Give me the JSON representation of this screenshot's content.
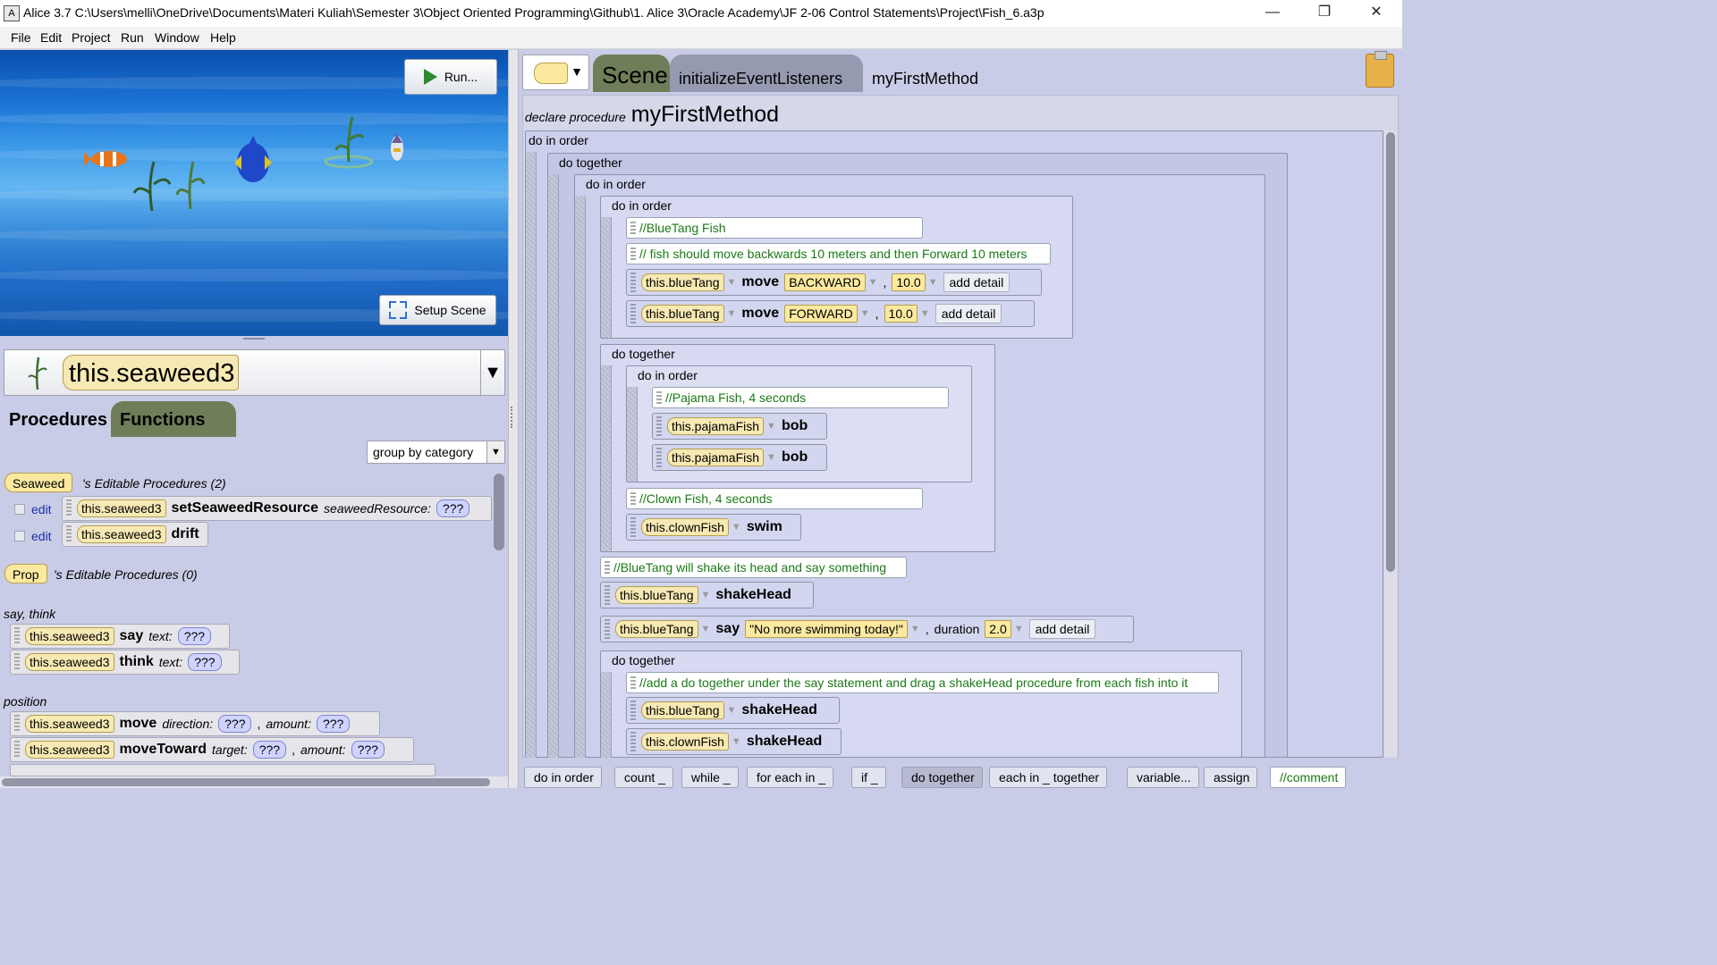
{
  "window": {
    "title": "Alice 3.7 C:\\Users\\melli\\OneDrive\\Documents\\Materi Kuliah\\Semester 3\\Object Oriented Programming\\Github\\1. Alice 3\\Oracle Academy\\JF 2-06 Control Statements\\Project\\Fish_6.a3p",
    "minimize": "—",
    "restore": "❐",
    "close": "✕"
  },
  "menu": [
    "File",
    "Edit",
    "Project",
    "Run",
    "Window",
    "Help"
  ],
  "scene": {
    "run_label": "Run...",
    "setup_scene_label": "Setup Scene"
  },
  "selector": {
    "selected": "this.seaweed3",
    "arrow": "▼"
  },
  "left_tabs": {
    "procedures": "Procedures",
    "functions": "Functions"
  },
  "palette": {
    "group_by": "group by category",
    "seaweed_badge": "Seaweed",
    "seaweed_header": "'s Editable Procedures (2)",
    "prop_badge": "Prop",
    "prop_header": "'s Editable Procedures (0)",
    "edit": "edit",
    "editable": [
      {
        "obj": "this.seaweed3",
        "method": "setSeaweedResource",
        "arg": "seaweedResource:",
        "val": "???"
      },
      {
        "obj": "this.seaweed3",
        "method": "drift"
      }
    ],
    "cat_say_think": "say, think",
    "say": {
      "obj": "this.seaweed3",
      "method": "say",
      "arg": "text:",
      "val": "???"
    },
    "think": {
      "obj": "this.seaweed3",
      "method": "think",
      "arg": "text:",
      "val": "???"
    },
    "cat_position": "position",
    "move": {
      "obj": "this.seaweed3",
      "method": "move",
      "arg1": "direction:",
      "val1": "???",
      "comma": ",",
      "arg2": "amount:",
      "val2": "???"
    },
    "move_toward": {
      "obj": "this.seaweed3",
      "method": "moveToward",
      "arg1": "target:",
      "val1": "???",
      "comma": ",",
      "arg2": "amount:",
      "val2": "???"
    }
  },
  "editor": {
    "tabs": {
      "scene": "Scene",
      "listeners": "initializeEventListeners",
      "method": "myFirstMethod"
    },
    "declare_prefix": "declare procedure",
    "declare_name": "myFirstMethod",
    "labels": {
      "do_in_order": "do in order",
      "do_together": "do together",
      "add_detail": "add detail",
      "duration": "duration"
    },
    "comments": {
      "c1": "//BlueTang Fish",
      "c2": "// fish should move backwards 10 meters and then Forward 10 meters",
      "c3": "//Pajama Fish, 4 seconds",
      "c4": "//Clown Fish, 4 seconds",
      "c5": "//BlueTang will shake its head and say something",
      "c6": "//add a do together under the say statement and drag a shakeHead procedure from each fish into it"
    },
    "objects": {
      "blueTang": "this.blueTang",
      "pajamaFish": "this.pajamaFish",
      "clownFish": "this.clownFish"
    },
    "methods": {
      "move": "move",
      "bob": "bob",
      "swim": "swim",
      "shakeHead": "shakeHead",
      "say": "say"
    },
    "values": {
      "backward": "BACKWARD",
      "forward": "FORWARD",
      "ten": "10.0",
      "say_text": "\"No more swimming today!\"",
      "two": "2.0",
      "comma": ","
    }
  },
  "controls": [
    "do in order",
    "count _",
    "while _",
    "for each in _",
    "if _",
    "do together",
    "each in _ together",
    "variable...",
    "assign",
    "//comment"
  ]
}
